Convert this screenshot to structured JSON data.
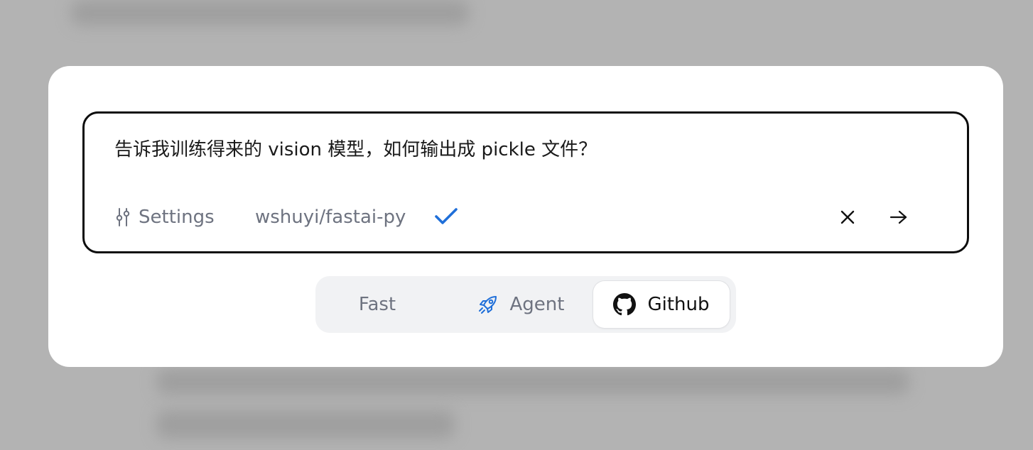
{
  "query": {
    "text": "告诉我训练得来的 vision 模型，如何输出成 pickle 文件？"
  },
  "toolbar": {
    "settings_label": "Settings",
    "settings_icon": "sliders-icon",
    "repo": "wshuyi/fastai-py",
    "repo_status_icon": "check-icon",
    "clear_icon": "close-icon",
    "submit_icon": "arrow-right-icon"
  },
  "modes": {
    "selected": "Github",
    "tabs": [
      {
        "label": "Fast",
        "icon": ""
      },
      {
        "label": "Agent",
        "icon": "rocket-icon"
      },
      {
        "label": "Github",
        "icon": "github-icon"
      }
    ]
  },
  "colors": {
    "accent": "#1f6fd9",
    "border": "#0d0d0d",
    "muted_text": "#6e7380",
    "switch_bg": "#f1f2f4"
  }
}
